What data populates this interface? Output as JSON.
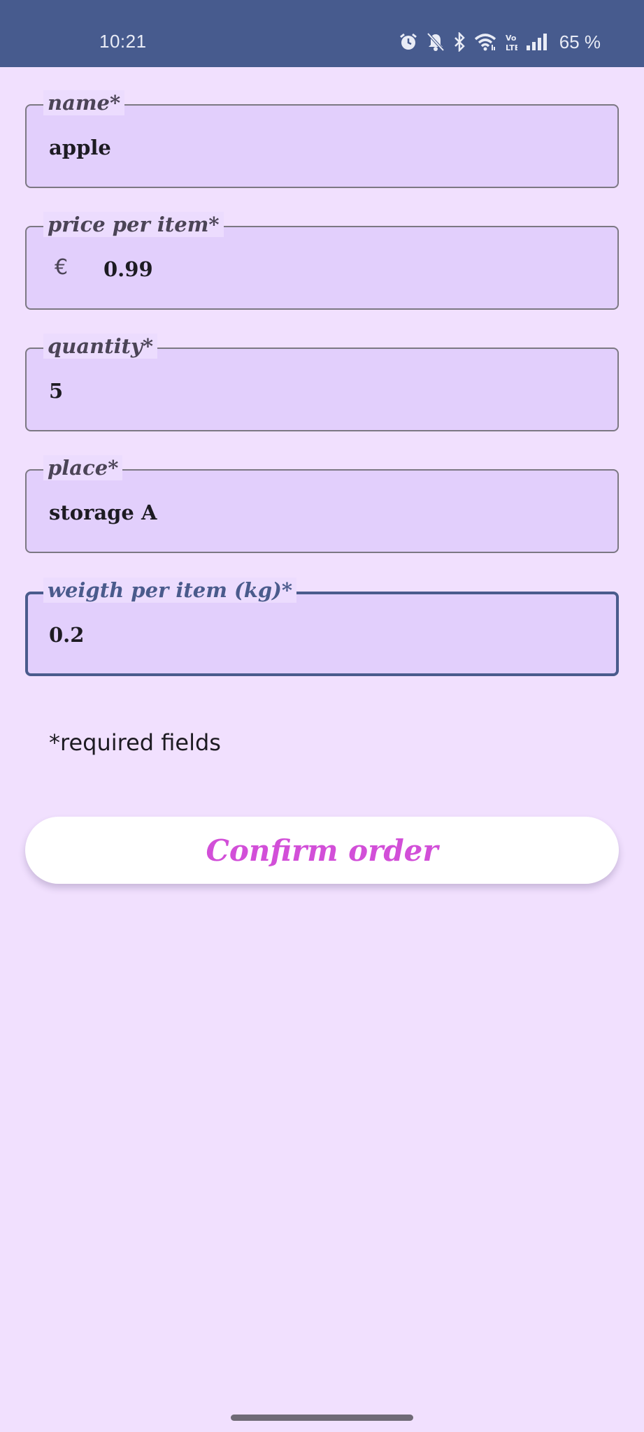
{
  "status_bar": {
    "time": "10:21",
    "battery": "65 %",
    "icons": [
      "alarm-icon",
      "bell-off-icon",
      "bluetooth-icon",
      "wifi-icon",
      "volte-icon",
      "signal-icon"
    ]
  },
  "form": {
    "fields": [
      {
        "label": "name*",
        "value": "apple"
      },
      {
        "label": "price per item*",
        "prefix": "€",
        "value": "0.99"
      },
      {
        "label": "quantity*",
        "value": "5"
      },
      {
        "label": "place*",
        "value": "storage A"
      },
      {
        "label": "weigth per item (kg)*",
        "value": "0.2"
      }
    ],
    "required_note": "*required fields",
    "confirm_label": "Confirm order"
  },
  "colors": {
    "background": "#f1e0fe",
    "status_bar": "#475b8e",
    "field_fill": "#e2cffc",
    "focus": "#4a5b8c",
    "button_text": "#d24fd8"
  }
}
